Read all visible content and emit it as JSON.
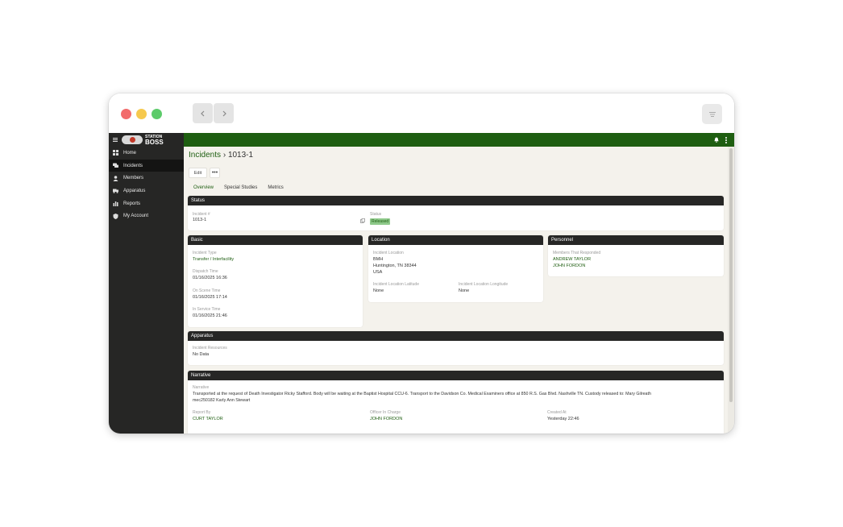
{
  "window": {
    "controls": [
      "close",
      "minimize",
      "zoom"
    ],
    "nav": {
      "back_icon": "chevron-left-icon",
      "forward_icon": "chevron-right-icon"
    },
    "menu_icon": "menu-lines-icon"
  },
  "sidebar": {
    "logo": {
      "line1": "STATION",
      "line2": "BOSS"
    },
    "items": [
      {
        "label": "Home",
        "icon": "grid-icon",
        "active": false
      },
      {
        "label": "Incidents",
        "icon": "chat-icon",
        "active": true
      },
      {
        "label": "Members",
        "icon": "person-icon",
        "active": false
      },
      {
        "label": "Apparatus",
        "icon": "truck-icon",
        "active": false
      },
      {
        "label": "Reports",
        "icon": "bar-chart-icon",
        "active": false
      },
      {
        "label": "My Account",
        "icon": "shield-icon",
        "active": false
      }
    ]
  },
  "header": {
    "breadcrumb_root": "Incidents",
    "separator": "›",
    "breadcrumb_current": "1013-1"
  },
  "actions": {
    "edit_label": "Edit",
    "more_label": "•••"
  },
  "tabs": [
    {
      "label": "Overview",
      "active": true
    },
    {
      "label": "Special Studies",
      "active": false
    },
    {
      "label": "Metrics",
      "active": false
    }
  ],
  "status_card": {
    "title": "Status",
    "incident_number_label": "Incident #",
    "incident_number": "1013-1",
    "status_label": "Status",
    "status_value": "Released"
  },
  "basic_card": {
    "title": "Basic",
    "incident_type_label": "Incident Type",
    "incident_type": "Transfer / Interfacility",
    "dispatch_time_label": "Dispatch Time",
    "dispatch_time": "01/16/2025 16:36",
    "on_scene_time_label": "On Scene Time",
    "on_scene_time": "01/16/2025 17:14",
    "in_service_time_label": "In Service Time",
    "in_service_time": "01/16/2025 21:46"
  },
  "location_card": {
    "title": "Location",
    "incident_location_label": "Incident Location",
    "location_line1": "BMH",
    "location_line2": "Huntington, TN 38344",
    "location_line3": "USA",
    "latitude_label": "Incident Location Latitude",
    "latitude": "None",
    "longitude_label": "Incident Location Longitude",
    "longitude": "None"
  },
  "personnel_card": {
    "title": "Personnel",
    "members_label": "Members That Responded",
    "members": [
      "ANDREW TAYLOR",
      "JOHN FORDON"
    ]
  },
  "apparatus_card": {
    "title": "Apparatus",
    "resources_label": "Incident Resources",
    "resources_value": "No Data"
  },
  "narrative_card": {
    "title": "Narrative",
    "narrative_label": "Narrative",
    "narrative_line1": "Transported at the request of Death Investigator Ricky Stafford. Body will be waiting at the Baptist Hospital CCU-6. Transport to the Davidson Co. Medical Examiners office at 850 R.S. Gas Blvd. Nashville TN. Custody released to: Mary Gilreath",
    "narrative_line2": "mec250182 Karly Ann Stewart",
    "report_by_label": "Report By",
    "report_by": "CURT TAYLOR",
    "officer_label": "Officer In Charge",
    "officer": "JOHN FORDON",
    "created_label": "Created At",
    "created": "Yesterday 22:46"
  },
  "colors": {
    "brand_green": "#1e5e11",
    "sidebar_bg": "#262625",
    "content_bg": "#f4f2ec"
  }
}
